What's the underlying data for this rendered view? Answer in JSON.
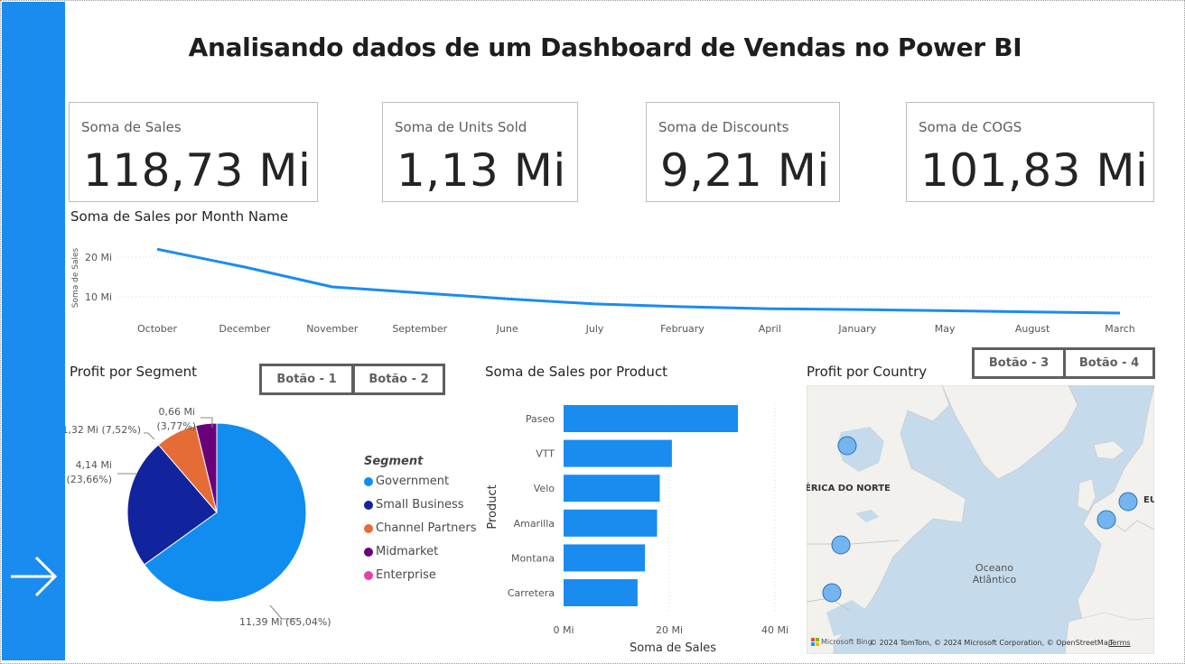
{
  "header": {
    "title": "Analisando dados de um Dashboard de Vendas no Power BI"
  },
  "kpis": [
    {
      "label": "Soma de Sales",
      "value": "118,73 Mi"
    },
    {
      "label": "Soma de Units Sold",
      "value": "1,13 Mi"
    },
    {
      "label": "Soma de Discounts",
      "value": "9,21 Mi"
    },
    {
      "label": "Soma de COGS",
      "value": "101,83 Mi"
    }
  ],
  "buttons": {
    "b1": "Botão - 1",
    "b2": "Botão - 2",
    "b3": "Botão - 3",
    "b4": "Botão - 4"
  },
  "sidebar": {
    "icon": "arrow-right-icon",
    "color": "#1a8cf0"
  },
  "line_chart": {
    "title": "Soma de Sales por Month Name",
    "ylabel": "Soma de Sales",
    "yticks": [
      "20 Mi",
      "10 Mi"
    ]
  },
  "pie_chart": {
    "title": "Profit por Segment",
    "legend_title": "Segment",
    "labels": [
      "11,39 Mi (65,04%)",
      "4,14 Mi",
      "(23,66%)",
      "1,32 Mi (7,52%)",
      "0,66 Mi",
      "(3,77%)"
    ]
  },
  "bar_chart": {
    "title": "Soma de Sales por Product",
    "xlabel": "Soma de Sales",
    "ylabel": "Product",
    "xticks": [
      "0 Mi",
      "20 Mi",
      "40 Mi"
    ]
  },
  "map": {
    "title": "Profit por Country",
    "labels": {
      "north_america": "ÉRICA DO NORTE",
      "ocean_line1": "Oceano",
      "ocean_line2": "Atlântico",
      "europe": "EU"
    },
    "credit": "© 2024 TomTom, © 2024 Microsoft Corporation, © OpenStreetMap",
    "terms": "Terms",
    "logo": "Microsoft Bing"
  },
  "chart_data": [
    {
      "type": "line",
      "title": "Soma de Sales por Month Name",
      "ylabel": "Soma de Sales",
      "categories": [
        "October",
        "December",
        "November",
        "September",
        "June",
        "July",
        "February",
        "April",
        "January",
        "May",
        "August",
        "March"
      ],
      "values": [
        22.0,
        17.5,
        12.5,
        11.0,
        9.5,
        8.2,
        7.5,
        7.0,
        6.8,
        6.5,
        6.2,
        5.9
      ],
      "unit": "Mi",
      "ylim": [
        5,
        24
      ],
      "color": "#1a8cf0",
      "grid": true
    },
    {
      "type": "pie",
      "title": "Profit por Segment",
      "legend_title": "Segment",
      "categories": [
        "Government",
        "Small Business",
        "Channel Partners",
        "Midmarket",
        "Enterprise"
      ],
      "values": [
        11.39,
        4.14,
        1.32,
        0.66,
        0.0
      ],
      "percents": [
        65.04,
        23.66,
        7.52,
        3.77,
        0.0
      ],
      "colors": [
        "#118df0",
        "#12239e",
        "#e66c37",
        "#6b007b",
        "#e044a7"
      ],
      "legend": "right"
    },
    {
      "type": "bar",
      "orientation": "horizontal",
      "title": "Soma de Sales por Product",
      "xlabel": "Soma de Sales",
      "ylabel": "Product",
      "categories": [
        "Paseo",
        "VTT",
        "Velo",
        "Amarilla",
        "Montana",
        "Carretera"
      ],
      "values": [
        33.0,
        20.5,
        18.2,
        17.7,
        15.4,
        14.0
      ],
      "unit": "Mi",
      "xlim": [
        0,
        40
      ],
      "color": "#1a8cf0"
    }
  ]
}
